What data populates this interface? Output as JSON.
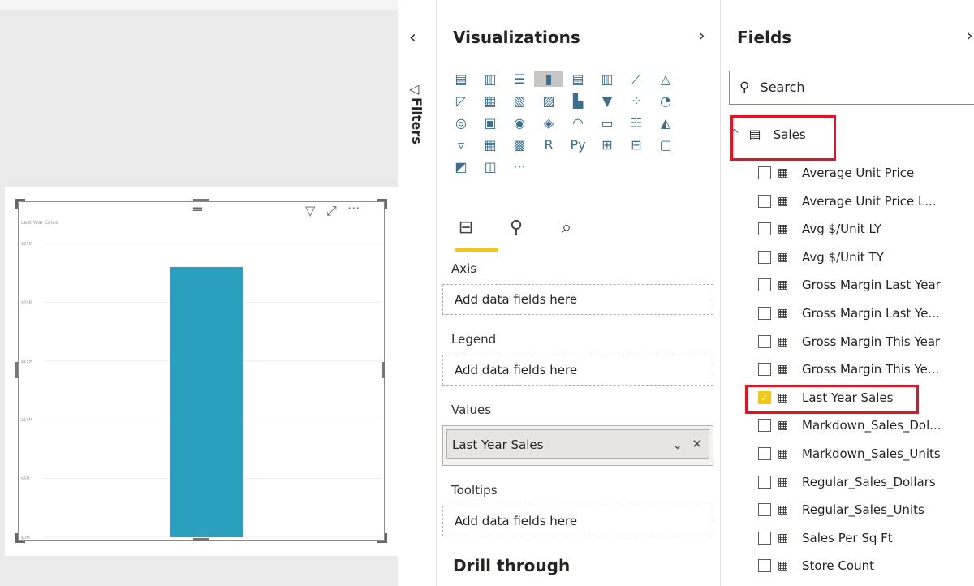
{
  "chart_data": {
    "type": "bar",
    "categories": [
      ""
    ],
    "values": [
      23
    ],
    "title": "Last Year Sales",
    "ylabels": [
      "$0M",
      "$5M",
      "$10M",
      "$15M",
      "$20M",
      "$25M"
    ],
    "ylim": [
      0,
      25
    ],
    "color": "#2aa0be",
    "grid": true
  },
  "visual_header": {
    "more_label": "···"
  },
  "filters_pane": {
    "collapse_icon": "chevron-left-icon",
    "label": "Filters"
  },
  "visualizations": {
    "title": "Visualizations",
    "expand_icon": "chevron-right-icon",
    "more_label": "···",
    "wells": [
      {
        "label": "Axis",
        "placeholder": "Add data fields here"
      },
      {
        "label": "Legend",
        "placeholder": "Add data fields here"
      },
      {
        "label": "Values",
        "value": "Last Year Sales"
      },
      {
        "label": "Tooltips",
        "placeholder": "Add data fields here"
      }
    ],
    "drill_through": "Drill through"
  },
  "fields": {
    "title": "Fields",
    "search_placeholder": "Search",
    "table_name": "Sales",
    "items": [
      {
        "label": "Average Unit Price",
        "checked": false
      },
      {
        "label": "Average Unit Price L...",
        "checked": false
      },
      {
        "label": "Avg $/Unit LY",
        "checked": false
      },
      {
        "label": "Avg $/Unit TY",
        "checked": false
      },
      {
        "label": "Gross Margin Last Year",
        "checked": false
      },
      {
        "label": "Gross Margin Last Ye...",
        "checked": false
      },
      {
        "label": "Gross Margin This Year",
        "checked": false
      },
      {
        "label": "Gross Margin This Ye...",
        "checked": false
      },
      {
        "label": "Last Year Sales",
        "checked": true
      },
      {
        "label": "Markdown_Sales_Dol...",
        "checked": false
      },
      {
        "label": "Markdown_Sales_Units",
        "checked": false
      },
      {
        "label": "Regular_Sales_Dollars",
        "checked": false
      },
      {
        "label": "Regular_Sales_Units",
        "checked": false
      },
      {
        "label": "Sales Per Sq Ft",
        "checked": false
      },
      {
        "label": "Store Count",
        "checked": false
      }
    ]
  },
  "colors": {
    "accent": "#f2c811",
    "highlight": "#e81123",
    "bar": "#2aa0be"
  }
}
